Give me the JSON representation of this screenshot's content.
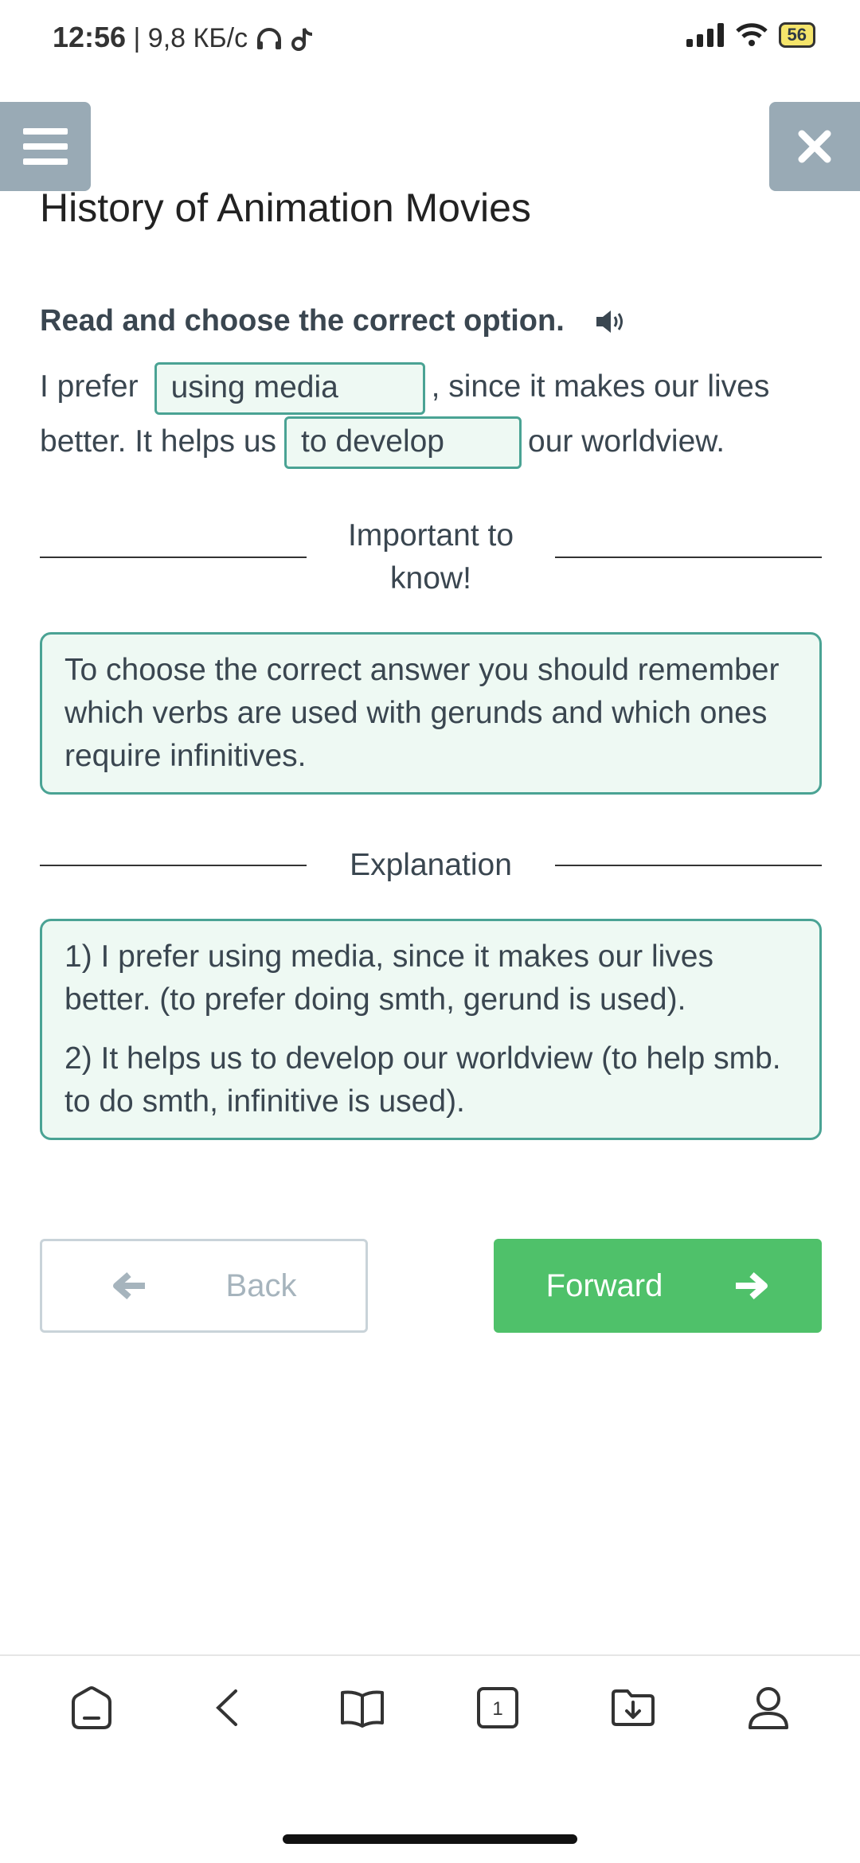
{
  "status_bar": {
    "time": "12:56",
    "network_speed": " | 9,8 КБ/с",
    "battery": "56"
  },
  "header": {
    "menu_icon": "hamburger-icon",
    "close_icon": "close-icon",
    "title": "History of Animation Movies"
  },
  "exercise": {
    "instruction": "Read and choose the correct option.",
    "audio_icon": "speaker-icon",
    "sentence_part1": "I prefer",
    "gap1_value": "using media",
    "sentence_part2": ", since it makes our lives better. It helps us",
    "gap2_value": "to develop",
    "sentence_part3": "our worldview."
  },
  "important": {
    "heading": "Important to know!",
    "text": "To choose the correct answer you should remember which verbs are used with gerunds and which ones require infinitives."
  },
  "explanation": {
    "heading": "Explanation",
    "items": [
      "1) I prefer using media, since it makes our lives better. (to prefer doing smth, gerund is used).",
      "2) It helps us to develop our worldview (to help smb. to do smth, infinitive is used)."
    ]
  },
  "navigation": {
    "back_label": "Back",
    "forward_label": "Forward"
  },
  "bottom_nav": {
    "items": [
      "home-icon",
      "back-arrow-icon",
      "book-icon",
      "tabs-icon",
      "downloads-folder-icon",
      "profile-icon"
    ],
    "tabs_count": "1"
  },
  "colors": {
    "accent_green": "#4fc16a",
    "box_border": "#4aa394",
    "box_fill": "#eef9f3",
    "header_button": "#99aab5"
  }
}
